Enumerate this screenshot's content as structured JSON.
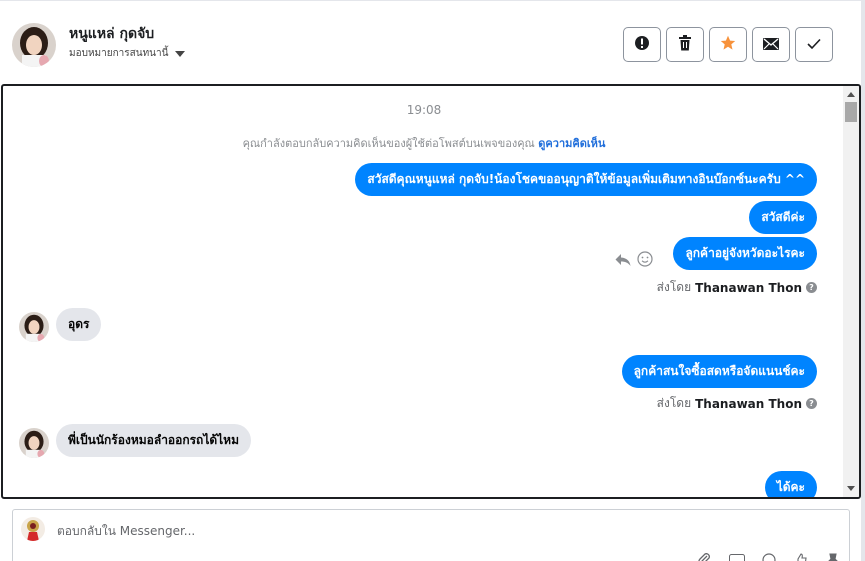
{
  "header": {
    "contact_name": "หนูแหล่ กุดจับ",
    "assign_label": "มอบหมายการสนทนานี้"
  },
  "toolbar": {
    "buttons": [
      "alert-icon",
      "trash-icon",
      "star-icon",
      "envelope-icon",
      "check-icon"
    ],
    "star_color": "#f7923b"
  },
  "conversation": {
    "timestamp": "19:08",
    "notice_text": "คุณกำลังตอบกลับความคิดเห็นของผู้ใช้ต่อโพสต์บนเพจของคุณ",
    "notice_link": "ดูความคิดเห็น",
    "messages": [
      {
        "direction": "out",
        "text": "สวัสดีคุณหนูแหล่ กุดจับ!น้องโชคขออนุญาติให้ข้อมูลเพิ่มเติมทางอินบ๊อกซ์นะครับ ^^"
      },
      {
        "direction": "out",
        "text": "สวัสดีค่ะ"
      },
      {
        "direction": "out",
        "text": "ลูกค้าอยู่จังหวัดอะไรคะ"
      },
      {
        "direction": "in",
        "text": "อุดร"
      },
      {
        "direction": "out",
        "text": "ลูกค้าสนใจซื้อสดหรือจัดแนนช์คะ"
      },
      {
        "direction": "in",
        "text": "พี่เป็นนักร้องหมอลำออกรถได้ไหม"
      },
      {
        "direction": "out",
        "text": "ได้คะ"
      }
    ],
    "sent_by_prefix": "ส่งโดย",
    "sent_by_name": "Thanawan Thon",
    "bubble_color": "#0084ff"
  },
  "composer": {
    "placeholder": "ตอบกลับใน Messenger..."
  }
}
